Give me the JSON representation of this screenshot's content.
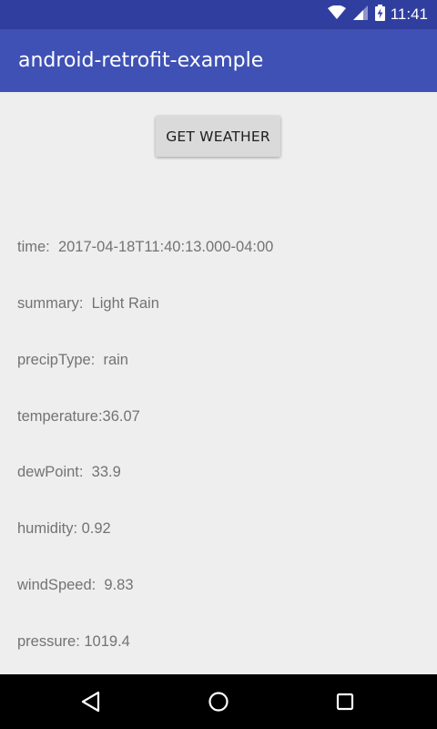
{
  "status_bar": {
    "time": "11:41",
    "icons": [
      "wifi-icon",
      "cell-signal-icon",
      "battery-charging-icon"
    ],
    "color": "#303F9F"
  },
  "app_bar": {
    "title": "android-retrofit-example",
    "color": "#3F51B5"
  },
  "main": {
    "button_label": "GET WEATHER",
    "weather": [
      {
        "label": "time:",
        "value": "2017-04-18T11:40:13.000-04:00"
      },
      {
        "label": "summary:",
        "value": "Light Rain"
      },
      {
        "label": "precipType:",
        "value": "rain"
      },
      {
        "label": "temperature:",
        "value": "36.07"
      },
      {
        "label": "dewPoint:",
        "value": "33.9"
      },
      {
        "label": "humidity:",
        "value": "0.92"
      },
      {
        "label": "windSpeed:",
        "value": "9.83"
      },
      {
        "label": "pressure:",
        "value": "1019.4"
      }
    ]
  },
  "nav_bar": {
    "icons": [
      "back-icon",
      "home-icon",
      "recents-icon"
    ]
  }
}
